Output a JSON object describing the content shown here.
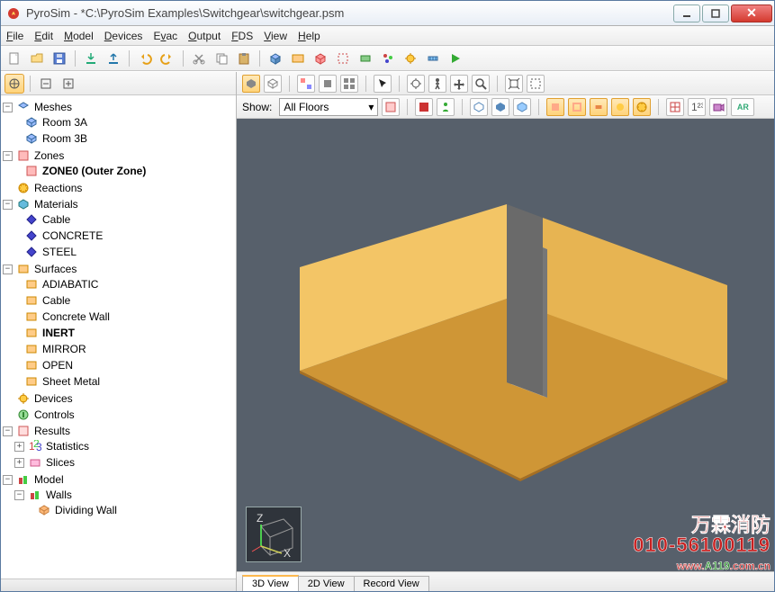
{
  "window": {
    "title": "PyroSim - *C:\\PyroSim Examples\\Switchgear\\switchgear.psm"
  },
  "menu": {
    "file": "File",
    "edit": "Edit",
    "model": "Model",
    "devices": "Devices",
    "evac": "Evac",
    "output": "Output",
    "fds": "FDS",
    "view": "View",
    "help": "Help"
  },
  "leftpane": {
    "show_label": "Show:",
    "floors": "All Floors"
  },
  "tree": {
    "meshes": "Meshes",
    "room3a": "Room 3A",
    "room3b": "Room 3B",
    "zones": "Zones",
    "zone0": "ZONE0 (Outer Zone)",
    "reactions": "Reactions",
    "materials": "Materials",
    "cable": "Cable",
    "concrete": "CONCRETE",
    "steel": "STEEL",
    "surfaces": "Surfaces",
    "adiabatic": "ADIABATIC",
    "cable2": "Cable",
    "concretewall": "Concrete Wall",
    "inert": "INERT",
    "mirror": "MIRROR",
    "open": "OPEN",
    "sheetmetal": "Sheet Metal",
    "devices": "Devices",
    "controls": "Controls",
    "results": "Results",
    "statistics": "Statistics",
    "slices": "Slices",
    "modelnode": "Model",
    "walls": "Walls",
    "divwall": "Dividing Wall"
  },
  "tabs": {
    "t3d": "3D View",
    "t2d": "2D View",
    "trec": "Record View"
  },
  "gizmo": {
    "x": "X",
    "z": "Z"
  },
  "watermark": {
    "line1": "万霖消防",
    "line2": "010-56100119",
    "line3a": "www.",
    "line3b": "A119",
    ".line3c": ".com.cn",
    "line3c": ".com.cn"
  },
  "ar_label": "AR"
}
